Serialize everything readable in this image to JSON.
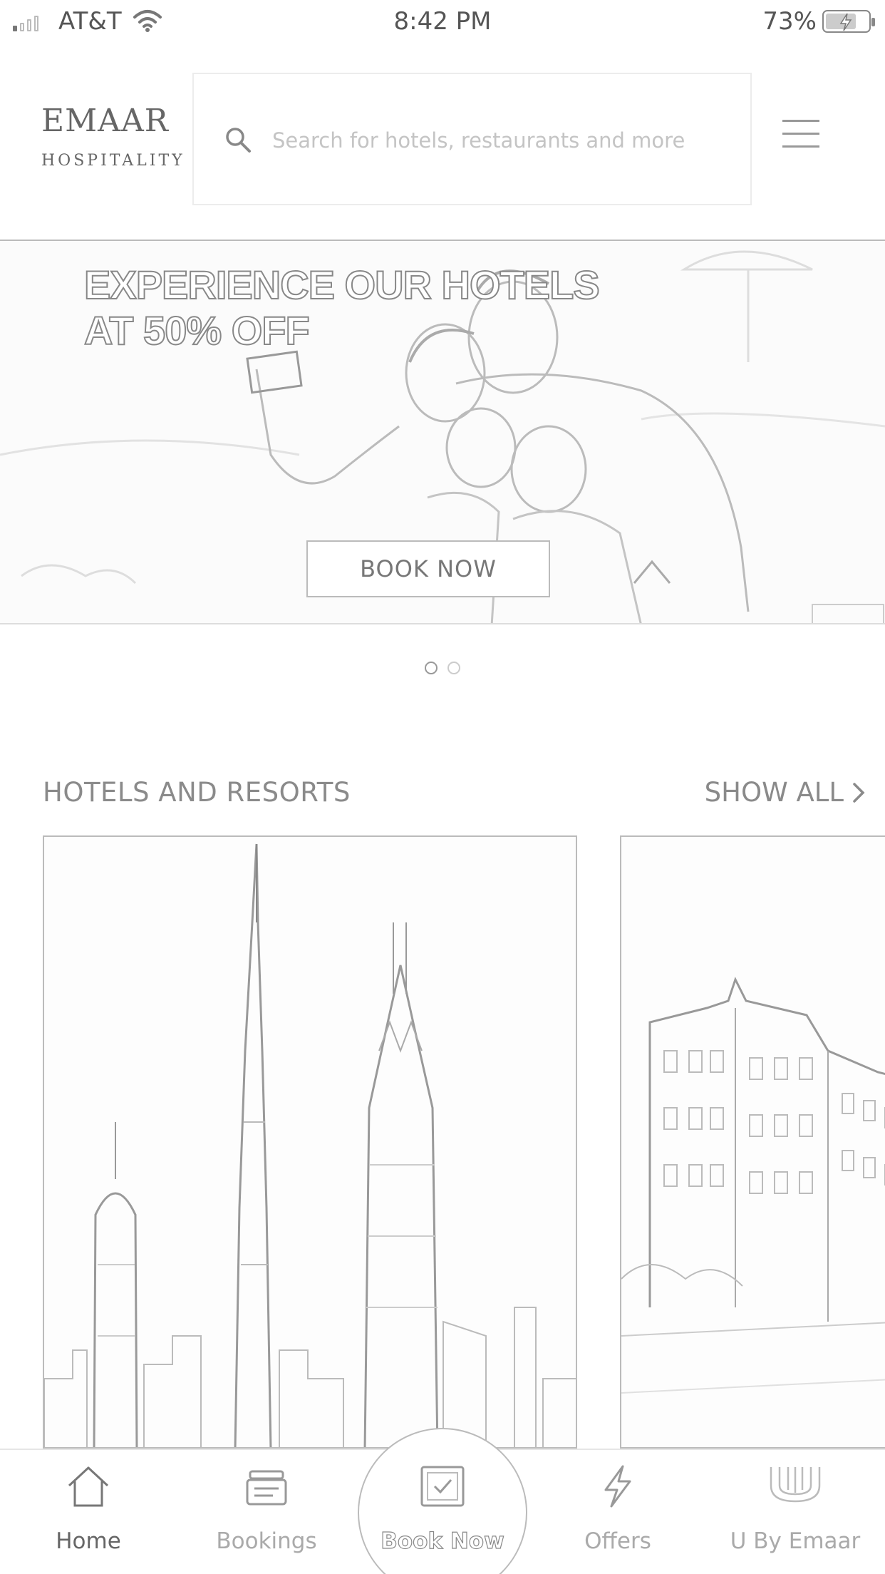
{
  "status_bar": {
    "carrier": "AT&T",
    "time": "8:42 PM",
    "battery_percent": "73%",
    "battery_level": 0.73,
    "icons": [
      "signal-icon",
      "wifi-icon",
      "battery-charging-icon"
    ]
  },
  "header": {
    "brand_name": "EMAAR",
    "brand_sub": "HOSPITALITY",
    "search_placeholder": "Search for hotels, restaurants and more",
    "search_icon": "search-icon",
    "menu_icon": "hamburger-menu-icon"
  },
  "banner": {
    "headline_line1": "EXPERIENCE OUR HOTELS",
    "headline_line2": "AT 50% OFF",
    "cta_label": "BOOK NOW",
    "slides_total": 2,
    "active_slide": 1
  },
  "hotels_section": {
    "title": "HOTELS AND RESORTS",
    "show_all_label": "SHOW ALL",
    "show_all_icon": "chevron-right-icon",
    "cards": [
      {
        "image": "downtown-dubai-skyline"
      },
      {
        "image": "hotel-building"
      }
    ]
  },
  "tab_bar": {
    "tabs": [
      {
        "label": "Home",
        "icon": "home-icon",
        "active": true
      },
      {
        "label": "Bookings",
        "icon": "bookings-icon",
        "active": false
      },
      {
        "label": "Book Now",
        "icon": "book-now-icon",
        "active": false
      },
      {
        "label": "Offers",
        "icon": "lightning-icon",
        "active": false
      },
      {
        "label": "U By Emaar",
        "icon": "u-by-emaar-icon",
        "active": false
      }
    ]
  }
}
